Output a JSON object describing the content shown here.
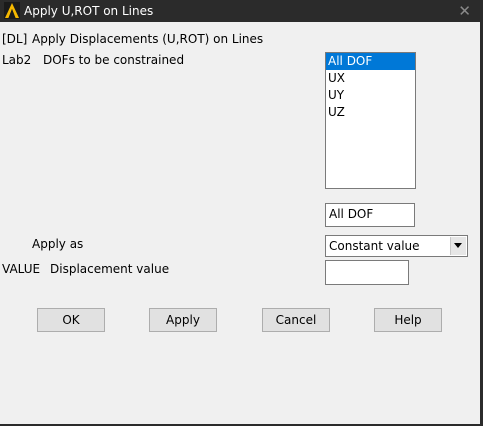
{
  "window": {
    "title": "Apply U,ROT on Lines"
  },
  "form": {
    "header_code": "[DL]",
    "header_text": "Apply Displacements (U,ROT) on Lines",
    "lab2_code": "Lab2",
    "lab2_text": "DOFs to be constrained",
    "dof_options": [
      "All DOF",
      "UX",
      "UY",
      "UZ"
    ],
    "dof_selected": "All DOF",
    "dof_text_value": "All DOF",
    "apply_as_label": "Apply as",
    "apply_as_value": "Constant value",
    "value_code": "VALUE",
    "value_text": "Displacement value",
    "displacement_value": ""
  },
  "buttons": {
    "ok": "OK",
    "apply": "Apply",
    "cancel": "Cancel",
    "help": "Help"
  },
  "colors": {
    "selection": "#0078d7",
    "dialog_bg": "#f0f0f0",
    "titlebar_bg": "#2b2b2b"
  }
}
